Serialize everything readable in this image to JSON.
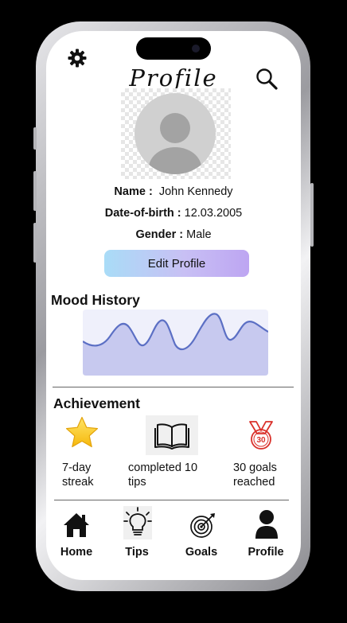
{
  "header": {
    "title": "Profile"
  },
  "profile": {
    "name_label": "Name :",
    "name_value": "John Kennedy",
    "dob_label": "Date-of-birth :",
    "dob_value": "12.03.2005",
    "gender_label": "Gender :",
    "gender_value": "Male",
    "edit_label": "Edit Profile"
  },
  "mood": {
    "title": "Mood History"
  },
  "achievement": {
    "title": "Achievement",
    "items": [
      {
        "icon": "star-icon",
        "line1": "7-day",
        "line2": "streak"
      },
      {
        "icon": "book-icon",
        "line1": "completed 10",
        "line2": "tips"
      },
      {
        "icon": "goal-medal-icon",
        "line1": "30 goals",
        "line2": "reached",
        "badge": "30"
      }
    ]
  },
  "nav": {
    "items": [
      {
        "icon": "home-icon",
        "label": "Home"
      },
      {
        "icon": "lightbulb-icon",
        "label": "Tips"
      },
      {
        "icon": "target-icon",
        "label": "Goals"
      },
      {
        "icon": "user-icon",
        "label": "Profile"
      }
    ]
  },
  "colors": {
    "chart_line": "#5b6fc4",
    "chart_fill": "#c7c9ef",
    "chart_bg": "#eff0fb",
    "accent_gradient_start": "#a9dcf7",
    "accent_gradient_end": "#bda5f2",
    "medal_red": "#d9312b"
  }
}
